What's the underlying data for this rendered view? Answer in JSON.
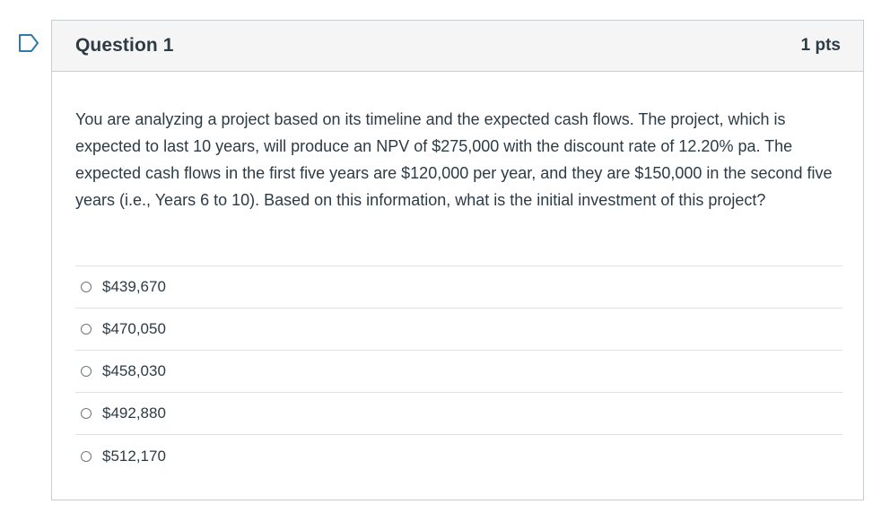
{
  "question": {
    "title": "Question 1",
    "points": "1 pts",
    "text": "You are analyzing a project based on its timeline and the expected cash flows. The project, which is expected to last 10 years, will produce an NPV of $275,000 with the discount rate of 12.20% pa. The expected cash flows in the first five years are $120,000 per year, and they are $150,000 in the second five years (i.e., Years 6 to 10). Based on this information, what is the initial investment of this project?",
    "answers": [
      {
        "label": "$439,670"
      },
      {
        "label": "$470,050"
      },
      {
        "label": "$458,030"
      },
      {
        "label": "$492,880"
      },
      {
        "label": "$512,170"
      }
    ]
  },
  "colors": {
    "flag": "#2d7ba6",
    "text": "#2d3b45",
    "header_bg": "#f5f5f5",
    "border": "#c7cdd1"
  },
  "icons": {
    "flag": "bookmark-flag-icon",
    "radio": "radio-unselected-icon"
  }
}
